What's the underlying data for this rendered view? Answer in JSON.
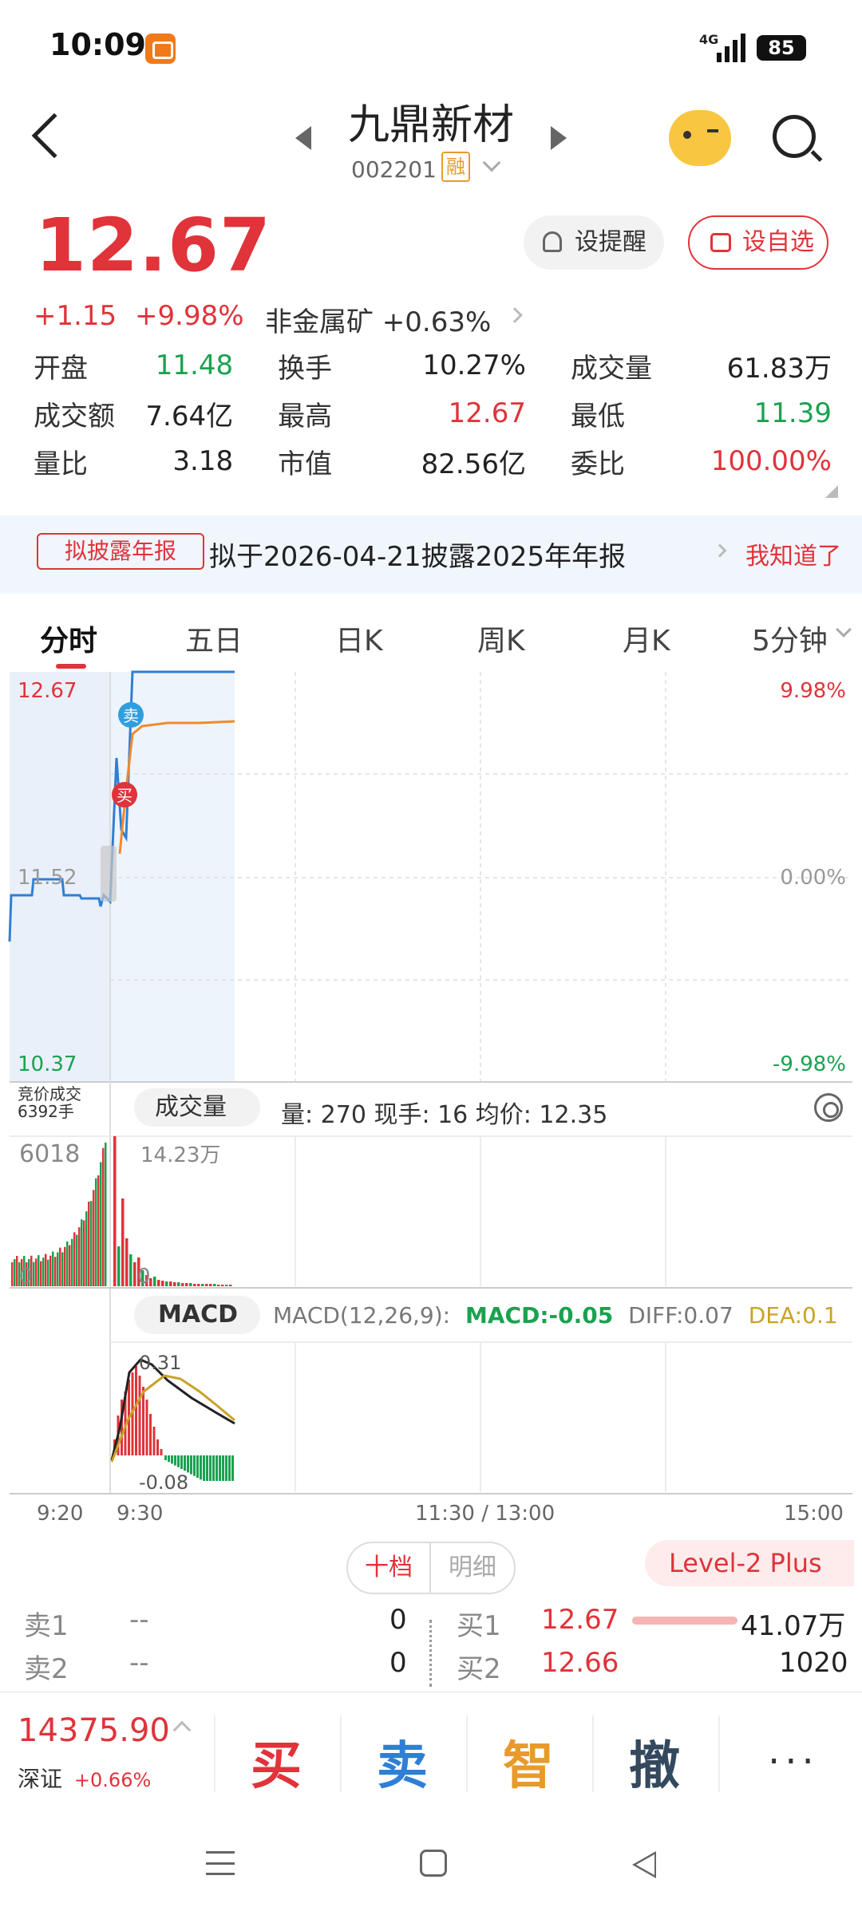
{
  "status_bar": {
    "time": "10:09",
    "network": "4G",
    "battery": "85"
  },
  "header": {
    "stock_name": "九鼎新材",
    "stock_code": "002201",
    "margin_tag": "融"
  },
  "quote": {
    "price": "12.67",
    "change": "+1.15",
    "change_pct": "+9.98%",
    "sector": "非金属矿 +0.63%",
    "remind_label": "设提醒",
    "add_label": "设自选"
  },
  "stats": [
    [
      {
        "label": "开盘",
        "value": "11.48",
        "color": "green"
      },
      {
        "label": "换手",
        "value": "10.27%",
        "color": "black"
      },
      {
        "label": "成交量",
        "value": "61.83万",
        "color": "black"
      }
    ],
    [
      {
        "label": "成交额",
        "value": "7.64亿",
        "color": "black"
      },
      {
        "label": "最高",
        "value": "12.67",
        "color": "red"
      },
      {
        "label": "最低",
        "value": "11.39",
        "color": "green"
      }
    ],
    [
      {
        "label": "量比",
        "value": "3.18",
        "color": "black"
      },
      {
        "label": "市值",
        "value": "82.56亿",
        "color": "black"
      },
      {
        "label": "委比",
        "value": "100.00%",
        "color": "red"
      }
    ]
  ],
  "notice": {
    "tag": "拟披露年报",
    "text": "拟于2026-04-21披露2025年年报",
    "action": "我知道了"
  },
  "tabs": [
    "分时",
    "五日",
    "日K",
    "周K",
    "月K",
    "5分钟"
  ],
  "chart": {
    "price_high": "12.67",
    "price_mid": "11.52",
    "price_low": "10.37",
    "pct_high": "9.98%",
    "pct_mid": "0.00%",
    "pct_low": "-9.98%",
    "sell_mark": "卖",
    "buy_mark": "买",
    "auction_label": "竞价成交",
    "auction_volume": "6392手",
    "vol_selector": "成交量",
    "vol_info": "量: 270   现手: 16   均价: 12.35",
    "vol_left_max": "6018",
    "vol_left_zero": "0",
    "vol_max": "14.23万",
    "vol_zero": "0",
    "macd_selector": "MACD",
    "macd_params": "MACD(12,26,9):",
    "macd_value": "MACD:-0.05",
    "diff_value": "DIFF:0.07",
    "dea_value": "DEA:0.1",
    "macd_high": "0.31",
    "macd_low": "-0.08",
    "times": [
      "9:20",
      "9:30",
      "11:30 / 13:00",
      "15:00"
    ],
    "colors": {
      "price_line": "#2f7fd6",
      "avg_line": "#f08a2a",
      "up": "#e0333a",
      "down": "#1aa250",
      "dea": "#c9a227"
    }
  },
  "orderbook": {
    "segment_active": "十档",
    "segment_other": "明细",
    "level2": "Level-2 Plus",
    "asks": [
      {
        "label": "卖1",
        "price": "--",
        "vol": "0"
      },
      {
        "label": "卖2",
        "price": "--",
        "vol": "0"
      }
    ],
    "bids": [
      {
        "label": "买1",
        "price": "12.67",
        "vol": "41.07万"
      },
      {
        "label": "买2",
        "price": "12.66",
        "vol": "1020"
      }
    ]
  },
  "bottom": {
    "index_value": "14375.90",
    "index_name": "深证",
    "index_change": "+0.66%",
    "buy": "买",
    "sell": "卖",
    "smart": "智",
    "cancel": "撤",
    "more": "···"
  }
}
